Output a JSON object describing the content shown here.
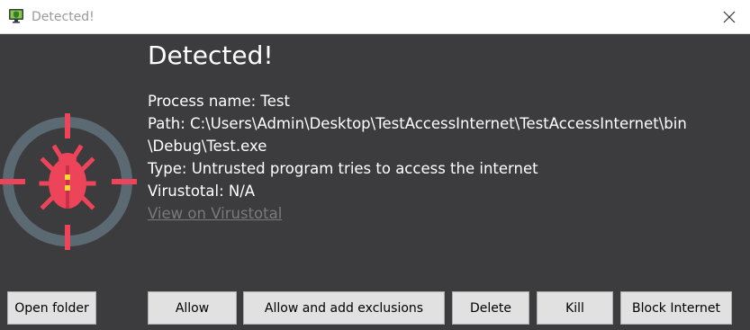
{
  "window": {
    "title": "Detected!"
  },
  "main": {
    "heading": "Detected!",
    "process_name": "Process name: Test",
    "path_line1": "Path: C:\\Users\\Admin\\Desktop\\TestAccessInternet\\TestAccessInternet\\bin",
    "path_line2": "\\Debug\\Test.exe",
    "type": "Type: Untrusted program tries to access the internet",
    "virustotal": "Virustotal: N/A",
    "virustotal_link": "View on Virustotal"
  },
  "buttons": {
    "open_folder": "Open folder",
    "allow": "Allow",
    "allow_exclusions": "Allow and add exclusions",
    "delete": "Delete",
    "kill": "Kill",
    "block_internet": "Block Internet"
  },
  "colors": {
    "background": "#3c3c3e",
    "accent_red": "#ee4459",
    "bug_yellow": "#ffd43b",
    "target_ring": "#5b6a72"
  },
  "icons": {
    "app": "shield-monitor-icon",
    "alert": "bug-target-icon",
    "close": "close-icon"
  }
}
